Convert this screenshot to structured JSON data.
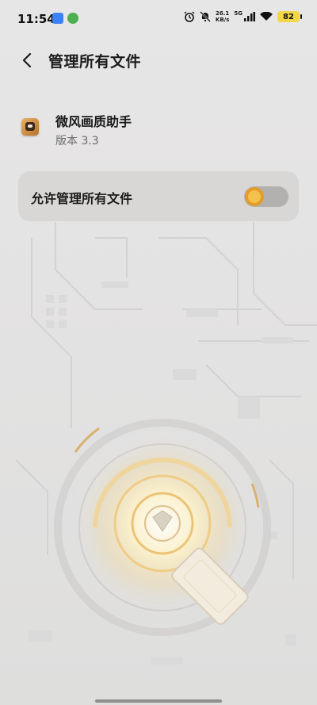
{
  "status_bar": {
    "time": "11:54",
    "network_speed": "26.1",
    "network_speed_unit": "KB/s",
    "network_type": "5G",
    "battery": "82",
    "icons": [
      "message-icon",
      "cloud-app-icon",
      "alarm-icon",
      "mute-icon",
      "signal-icon",
      "wifi-icon",
      "battery-icon"
    ]
  },
  "header": {
    "title": "管理所有文件",
    "back_icon": "back-arrow-icon"
  },
  "app": {
    "name": "微风画质助手",
    "version": "版本 3.3"
  },
  "permission": {
    "label": "允许管理所有文件",
    "enabled": false
  },
  "colors": {
    "accent": "#e39d28",
    "switch_track": "#b3b1b0",
    "card": "#d9d7d6",
    "background": "#e6e5e5"
  }
}
